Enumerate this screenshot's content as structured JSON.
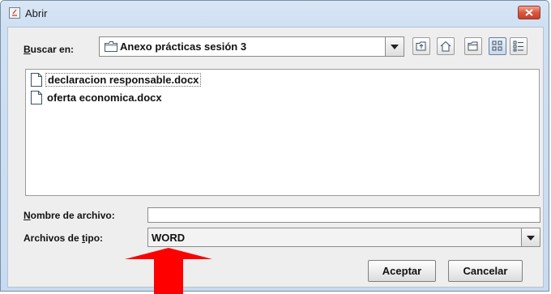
{
  "window": {
    "title": "Abrir"
  },
  "look_in": {
    "label_prefix": "B",
    "label_rest": "uscar en:",
    "folder": "Anexo prácticas sesión 3"
  },
  "toolbar": {
    "icons": [
      "up-folder-icon",
      "home-icon",
      "new-folder-icon",
      "list-view-icon",
      "details-view-icon"
    ]
  },
  "files": [
    {
      "name": "declaracion responsable.docx",
      "icon": "document-icon"
    },
    {
      "name": "oferta economica.docx",
      "icon": "document-icon"
    }
  ],
  "file_name": {
    "label_prefix": "N",
    "label_rest": "ombre de archivo:",
    "value": ""
  },
  "file_type": {
    "label_before": "Archivos de ",
    "label_mnemonic": "t",
    "label_after": "ipo:",
    "value": "WORD"
  },
  "buttons": {
    "accept": "Aceptar",
    "cancel": "Cancelar"
  },
  "annotation": {
    "arrow_color": "#ff0000"
  }
}
